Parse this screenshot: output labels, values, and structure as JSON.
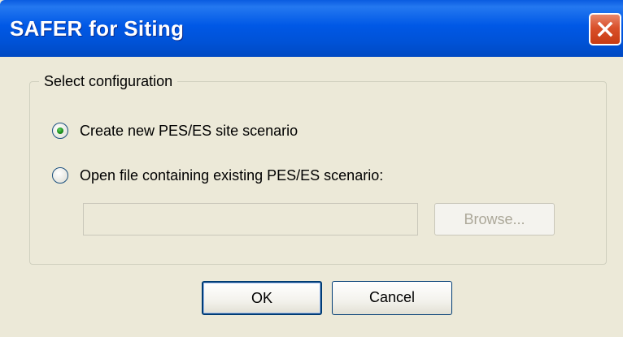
{
  "window": {
    "title": "SAFER for Siting"
  },
  "config_group": {
    "label": "Select configuration",
    "options": [
      {
        "label": "Create new PES/ES site scenario",
        "selected": true
      },
      {
        "label": "Open file containing existing PES/ES scenario:",
        "selected": false
      }
    ],
    "file_path": {
      "value": "",
      "enabled": false
    },
    "browse_label": "Browse..."
  },
  "buttons": {
    "ok_label": "OK",
    "cancel_label": "Cancel"
  },
  "colors": {
    "titlebar": "#0054e3",
    "dialog_background": "#ece9d8",
    "close_button": "#d9512b",
    "selected_radio": "#21a121",
    "disabled_text": "#aca899"
  },
  "icons": {
    "close": "close-icon"
  }
}
